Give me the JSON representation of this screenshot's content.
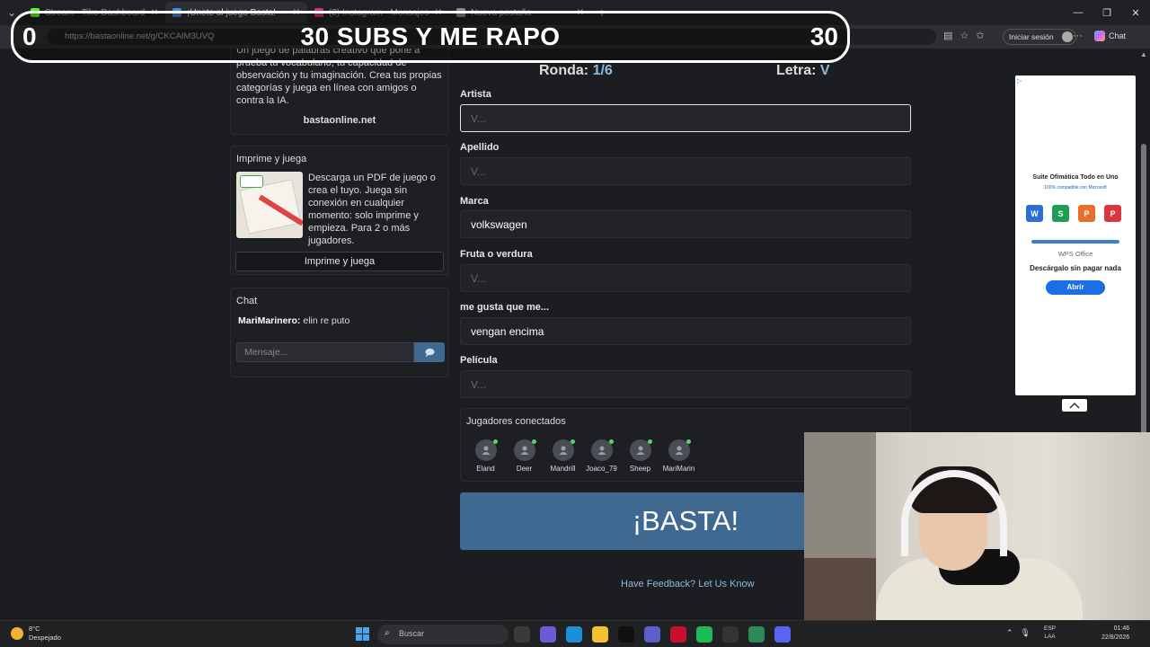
{
  "browser": {
    "tabs": [
      {
        "label": "Stream - Tiko Dashboard",
        "color": "#53fc18"
      },
      {
        "label": "¡Únete al juego Basta!",
        "color": "#4285f4"
      },
      {
        "label": "(2) Instagram • Mensajes",
        "color": "#e1306c"
      },
      {
        "label": "Nueva pestaña",
        "color": "#888888"
      }
    ],
    "url": "https://bastaonline.net/g/CKCAIM3UVQ",
    "login_label": "Iniciar sesión",
    "chat_label": "Chat"
  },
  "overlay": {
    "left_count": "0",
    "title": "30 SUBS Y ME RAPO",
    "right_count": "30"
  },
  "sidebar": {
    "intro_text": "Un juego de palabras creativo que pone a prueba tu vocabulario, tu capacidad de observación y tu imaginación. Crea tus propias categorías y juega en línea con amigos o contra la IA.",
    "site": "bastaonline.net",
    "print_title": "Imprime y juega",
    "print_desc": "Descarga un PDF de juego o crea el tuyo. Juega sin conexión en cualquier momento: solo imprime y empieza. Para 2 o más jugadores.",
    "print_button": "Imprime y juega",
    "chat_title": "Chat",
    "chat_msg_user": "MariMarinero:",
    "chat_msg_text": " elin re puto",
    "chat_placeholder": "Mensaje..."
  },
  "game": {
    "round_label": "Ronda:",
    "round_value": "1/6",
    "letter_label": "Letra:",
    "letter_value": "V",
    "fields": [
      {
        "label": "Artista",
        "value": "",
        "placeholder": "V..."
      },
      {
        "label": "Apellido",
        "value": "",
        "placeholder": "V..."
      },
      {
        "label": "Marca",
        "value": "volkswagen",
        "placeholder": "V..."
      },
      {
        "label": "Fruta o verdura",
        "value": "",
        "placeholder": "V..."
      },
      {
        "label": "me gusta que me...",
        "value": "vengan encima",
        "placeholder": "V..."
      },
      {
        "label": "Película",
        "value": "",
        "placeholder": "V..."
      }
    ],
    "players_title": "Jugadores conectados",
    "players": [
      "Eland",
      "Deer",
      "Mandrill",
      "Joaco_79",
      "Sheep",
      "MariMarin"
    ],
    "basta_button": "¡BASTA!",
    "feedback_link": "Have Feedback? Let Us Know"
  },
  "ad": {
    "title": "Suite Ofimática Todo en Uno",
    "subtitle": "100% compatible con Microsoft",
    "brand": "WPS Office",
    "tagline": "Descárgalo sin pagar nada",
    "button": "Abrir"
  },
  "taskbar": {
    "weather_temp": "8°C",
    "weather_desc": "Despejado",
    "search_placeholder": "Buscar",
    "lang_top": "ESP",
    "lang_bottom": "LAA",
    "time": "01:46",
    "date": "22/8/2026"
  }
}
